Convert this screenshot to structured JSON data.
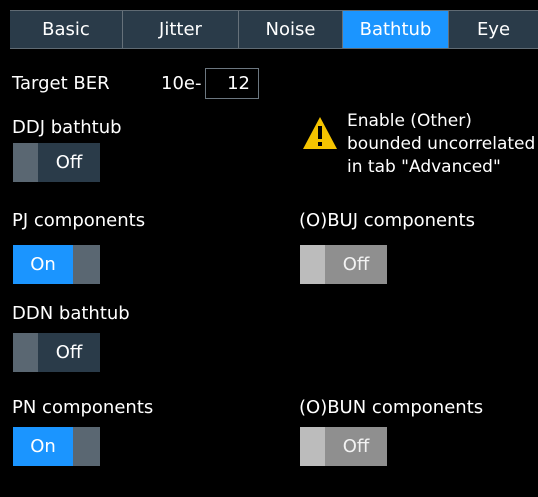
{
  "tabs": [
    {
      "label": "Basic",
      "active": false
    },
    {
      "label": "Jitter",
      "active": false
    },
    {
      "label": "Noise",
      "active": false
    },
    {
      "label": "Bathtub",
      "active": true
    },
    {
      "label": "Eye",
      "active": false
    }
  ],
  "target_ber": {
    "label": "Target BER",
    "prefix": "10e-",
    "value": "12"
  },
  "ddj_bathtub": {
    "label": "DDJ bathtub",
    "state": "Off"
  },
  "warning": {
    "icon": "warning-triangle-icon",
    "lines": [
      "Enable (Other)",
      "bounded uncorrelated",
      "in tab \"Advanced\""
    ]
  },
  "pj_components": {
    "label": "PJ components",
    "state": "On"
  },
  "obuj_components": {
    "label": "(O)BUJ components",
    "state": "Off",
    "enabled": false
  },
  "ddn_bathtub": {
    "label": "DDN bathtub",
    "state": "Off"
  },
  "pn_components": {
    "label": "PN components",
    "state": "On"
  },
  "obun_components": {
    "label": "(O)BUN components",
    "state": "Off",
    "enabled": false
  },
  "colors": {
    "background": "#000000",
    "accent": "#1b95ff",
    "control": "#2a3b49",
    "knob": "#5a6772",
    "disabled": "#8f8f8f",
    "warning": "#f5c400"
  }
}
